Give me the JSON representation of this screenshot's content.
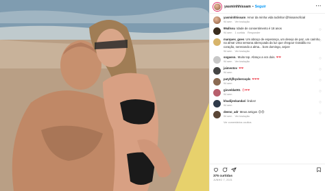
{
  "post": {
    "author": "yasminhhissam",
    "follow_label": "Seguir",
    "caption_user": "yasminhhissam",
    "caption_text": "Amor da minha vida todinha! @hissamoficial",
    "caption_time": "94 sem",
    "caption_translate": "Ver tradução"
  },
  "comments": [
    {
      "user": "99allssu",
      "text": "Idade de consentimento é 18 anos",
      "time": "94 sem",
      "likes": "1 curtida",
      "reply": "Responder"
    },
    {
      "user": "marques_goes",
      "text": "Um abraço de esperança, um desejo de paz, um carinho na alma! Uma semana abençoada da luz que chegou! Gratidão no coração, serenando a alma... bom domingo, anjos!",
      "time": "94 sem",
      "translate": "Ver tradução"
    },
    {
      "user": "sogasso.",
      "text": "Muito top. Abraço a vcs dois.",
      "time": "94 sem",
      "translate": "Ver tradução"
    },
    {
      "user": "jaimeotov",
      "text": "",
      "time": "94 sem"
    },
    {
      "user": "patyhjfbyxberoxpls",
      "text": "",
      "time": "94 sem"
    },
    {
      "user": "giovelda001",
      "text": "",
      "time": "94 sem"
    },
    {
      "user": "khadijeskandari",
      "text": "lindos!",
      "time": "94 sem"
    },
    {
      "user": "deeno_adr",
      "text": "Meus amigos",
      "time": "94 sem",
      "translate": "Ver tradução"
    }
  ],
  "hidden_comments_label": "Ver comentários ocultos",
  "footer": {
    "likes": "375 curtidas",
    "date": "JUNHO 7, 2021"
  },
  "icons": {
    "more": "more-options-icon",
    "heart": "heart-icon",
    "comment": "comment-icon",
    "share": "share-icon",
    "save": "bookmark-icon"
  },
  "colors": {
    "follow": "#0095f6",
    "heart_red": "#ed4956",
    "muted": "#8e8e8e"
  }
}
